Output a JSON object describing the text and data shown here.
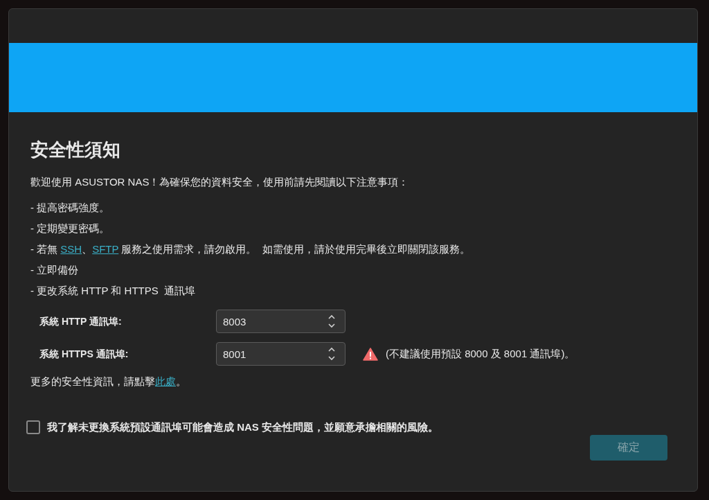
{
  "dialog": {
    "title": "安全性須知",
    "intro": "歡迎使用 ASUSTOR NAS！為確保您的資料安全，使用前請先閱讀以下注意事項：",
    "notes": [
      {
        "segments": [
          {
            "kind": "text",
            "text": "- 提高密碼強度。"
          }
        ]
      },
      {
        "segments": [
          {
            "kind": "text",
            "text": "- 定期變更密碼。"
          }
        ]
      },
      {
        "segments": [
          {
            "kind": "text",
            "text": "- 若無 "
          },
          {
            "kind": "link",
            "text": "SSH"
          },
          {
            "kind": "text",
            "text": "、"
          },
          {
            "kind": "link",
            "text": "SFTP"
          },
          {
            "kind": "text",
            "text": " 服務之使用需求，請勿啟用。  如需使用，請於使用完畢後立即關閉該服務。"
          }
        ]
      },
      {
        "segments": [
          {
            "kind": "text",
            "text": "- 立即備份"
          }
        ]
      },
      {
        "segments": [
          {
            "kind": "text",
            "text": "- 更改系統 HTTP 和 HTTPS  通訊埠"
          }
        ]
      }
    ],
    "ports": [
      {
        "label": "系統 HTTP 通訊埠:",
        "value": "8003",
        "warning": false
      },
      {
        "label": "系統 HTTPS 通訊埠:",
        "value": "8001",
        "warning": true,
        "warning_text": "(不建議使用預設 8000 及 8001 通訊埠)。"
      }
    ],
    "more_info": {
      "text": "更多的安全性資訊，請點擊",
      "link": "此處",
      "suffix": "。"
    },
    "agreement": {
      "label": "我了解未更換系統預設通訊埠可能會造成 NAS 安全性問題，並願意承擔相關的風險。",
      "checked": false
    },
    "confirm_button": {
      "label": "確定",
      "disabled": true
    }
  }
}
